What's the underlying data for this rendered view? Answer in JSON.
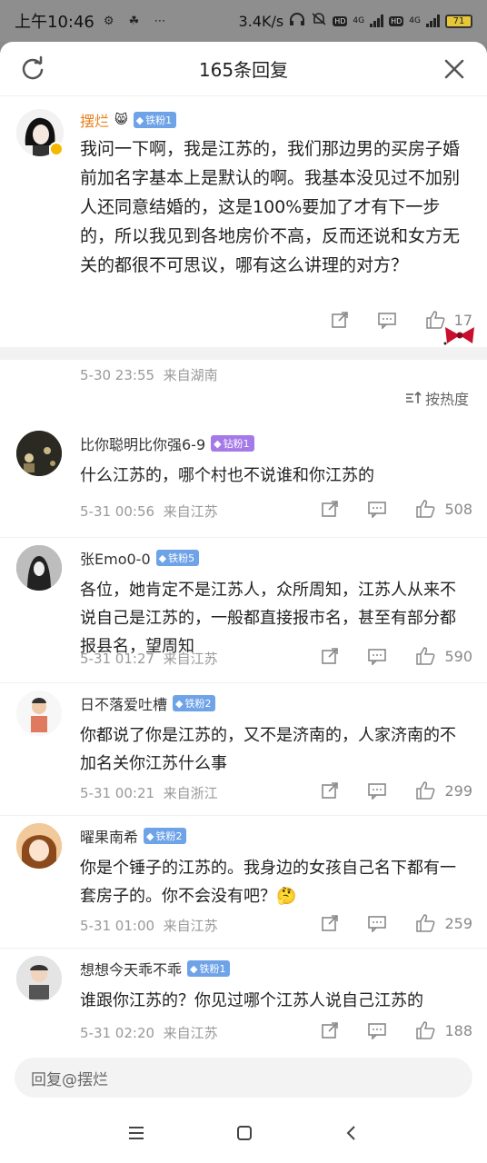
{
  "status_bar": {
    "time": "上午10:46",
    "notif_icons": "⚙ ☘ ⋯",
    "speed": "3.4K/s",
    "hd1": "HD",
    "hd2": "HD",
    "net1": "4G",
    "net2": "4G",
    "battery": "71"
  },
  "sheet": {
    "title": "165条回复"
  },
  "post": {
    "author": "摆烂",
    "fan_badge": "铁粉1",
    "content": "我问一下啊，我是江苏的，我们那边男的买房子婚前加名字基本上是默认的啊。我基本没见过不加别人还同意结婚的，这是100%要加了才有下一步的，所以我见到各地房价不高，反而还说和女方无关的都很不可思议，哪有这么讲理的对方？",
    "time": "5-30 23:55",
    "location": "来自湖南",
    "likes": "17"
  },
  "sort_label": "按热度",
  "replies": [
    {
      "name": "比你聪明比你强6-9",
      "badge": "钻粉1",
      "content": "什么江苏的，哪个村也不说谁和你江苏的",
      "time": "5-31 00:56",
      "location": "来自江苏",
      "likes": "508"
    },
    {
      "name": "张Emo0-0",
      "badge": "铁粉5",
      "content": "各位，她肯定不是江苏人，众所周知，江苏人从来不说自己是江苏的，一般都直接报市名，甚至有部分都报县名，望周知",
      "time": "5-31 01:27",
      "location": "来自江苏",
      "likes": "590"
    },
    {
      "name": "日不落爱吐槽",
      "badge": "铁粉2",
      "content": "你都说了你是江苏的，又不是济南的，人家济南的不加名关你江苏什么事",
      "time": "5-31 00:21",
      "location": "来自浙江",
      "likes": "299"
    },
    {
      "name": "曜果南希",
      "badge": "铁粉2",
      "content": "你是个锤子的江苏的。我身边的女孩自己名下都有一套房子的。你不会没有吧？🤔",
      "time": "5-31 01:00",
      "location": "来自江苏",
      "likes": "259"
    },
    {
      "name": "想想今天乖不乖",
      "badge": "铁粉1",
      "content": "谁跟你江苏的？你见过哪个江苏人说自己江苏的",
      "time": "5-31 02:20",
      "location": "来自江苏",
      "likes": "188"
    }
  ],
  "reply_input": {
    "placeholder": "回复@摆烂"
  },
  "colors": {
    "post_name": "#e8821e",
    "badge_blue": "#6fa3e8",
    "badge_purple": "#a47ae8",
    "badge_orange": "#f0a030"
  }
}
